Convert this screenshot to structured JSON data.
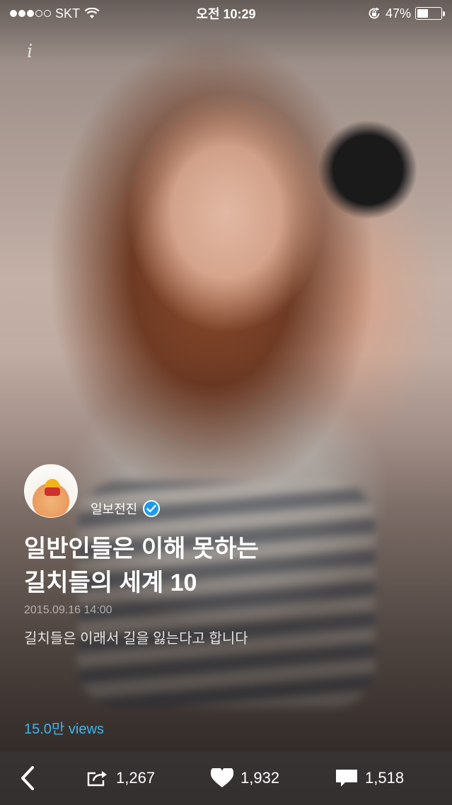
{
  "status_bar": {
    "carrier": "SKT",
    "time": "오전 10:29",
    "battery_percent": "47%",
    "battery_level": 0.47
  },
  "header": {
    "info_icon": "info-icon"
  },
  "post": {
    "author": "일보전진",
    "verified": true,
    "title_line1": "일반인들은 이해 못하는",
    "title_line2": "길치들의 세계 10",
    "date": "2015.09.16 14:00",
    "subtitle": "길치들은 이래서 길을 잃는다고 합니다",
    "views": "15.0만 views"
  },
  "toolbar": {
    "share_count": "1,267",
    "like_count": "1,932",
    "comment_count": "1,518"
  },
  "colors": {
    "accent": "#3fb4ec",
    "verified_badge": "#1e9be8"
  }
}
